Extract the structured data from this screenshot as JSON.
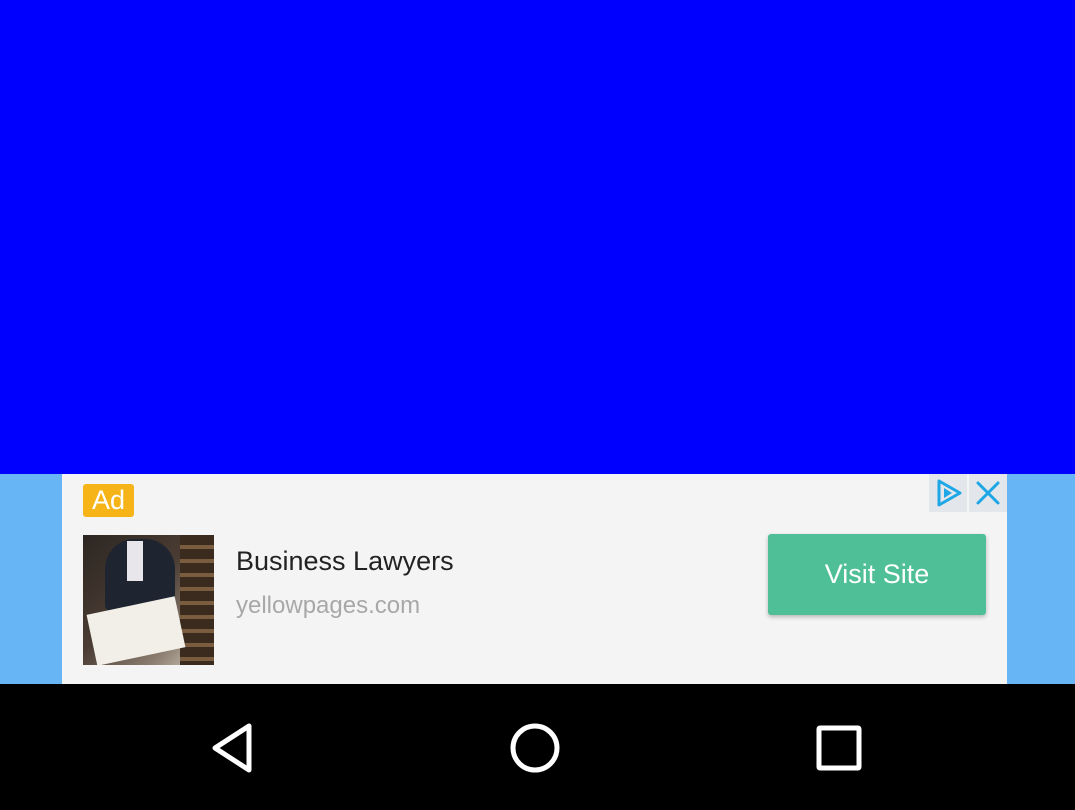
{
  "ad": {
    "badge": "Ad",
    "title": "Business Lawyers",
    "url": "yellowpages.com",
    "cta_label": "Visit Site",
    "info_icon": "adchoices-play-icon",
    "close_icon": "close-icon",
    "thumbnail_icon": "lawyer-signing-document-image"
  },
  "nav": {
    "back_icon": "back-triangle-icon",
    "home_icon": "home-circle-icon",
    "recents_icon": "recents-square-icon"
  },
  "colors": {
    "app_background": "#0000ff",
    "ad_strip": "#67b5f5",
    "ad_badge": "#f6b419",
    "cta": "#4fbf97",
    "adchoices_accent": "#1ea7e6",
    "nav_bar": "#000000"
  }
}
